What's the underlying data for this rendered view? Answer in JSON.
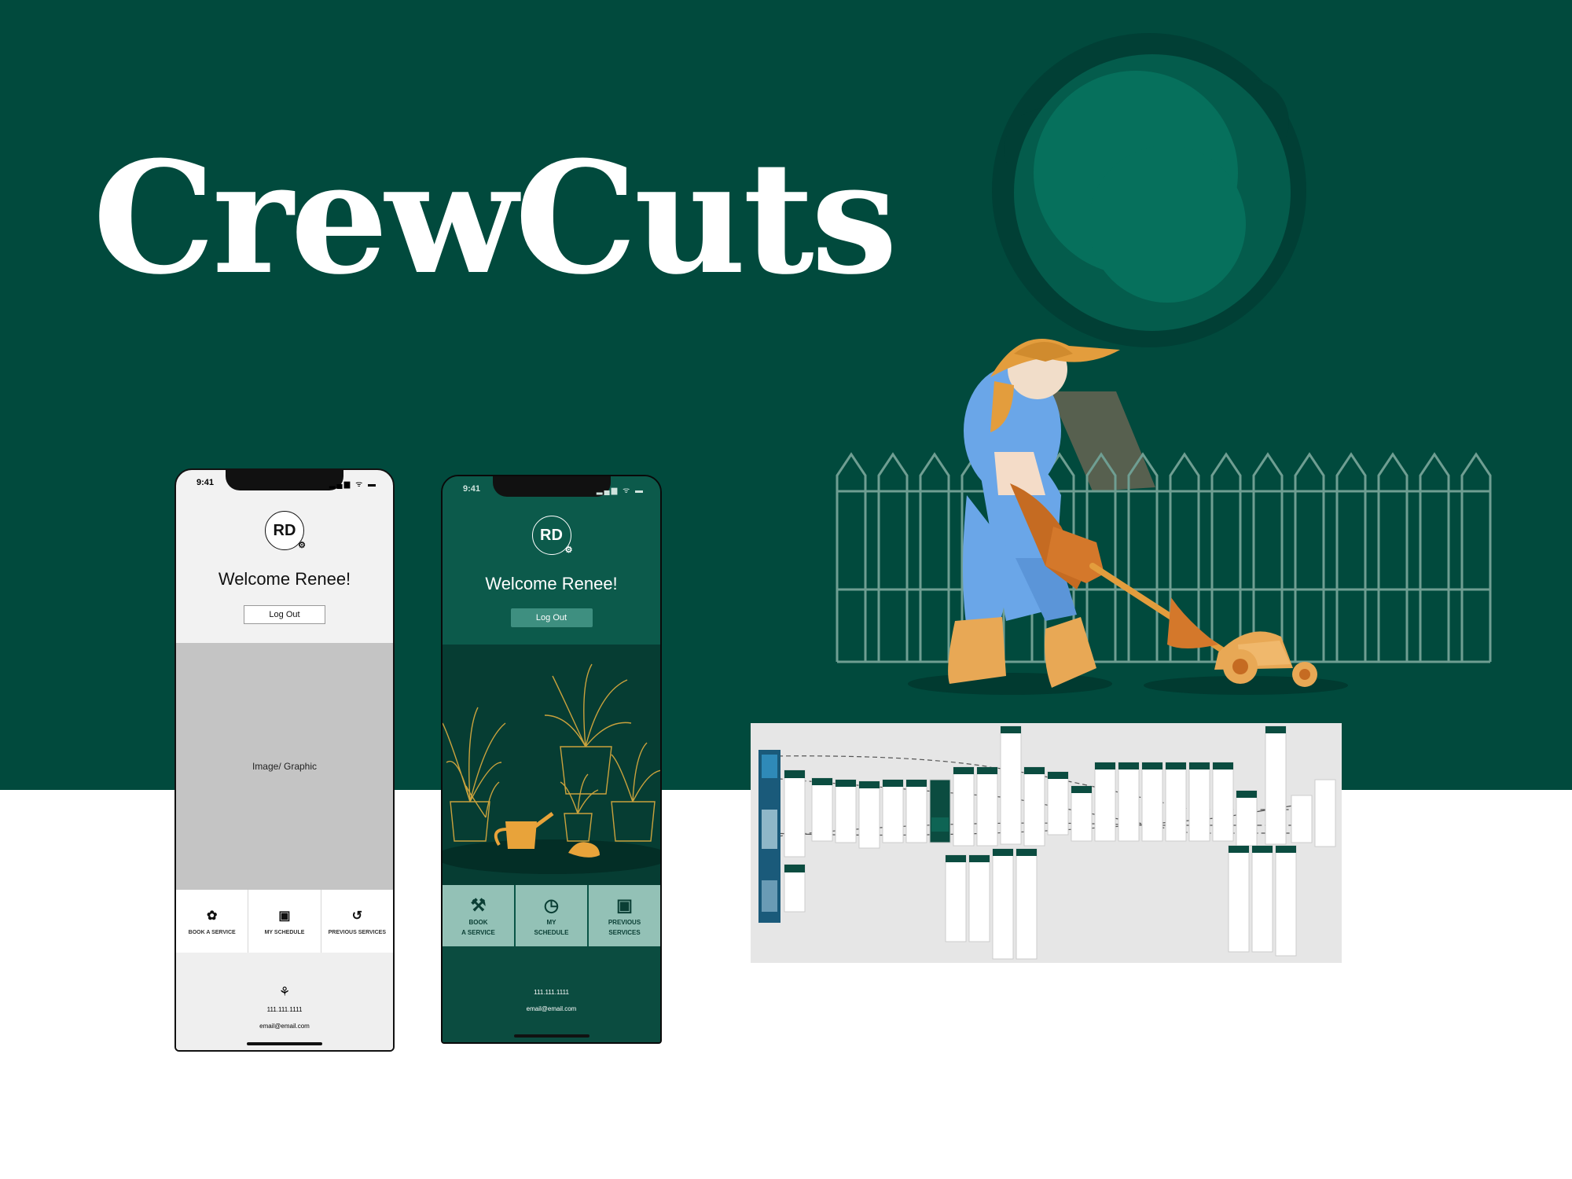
{
  "brand": {
    "title": "CrewCuts"
  },
  "colors": {
    "hero_green": "#014a3d",
    "accent_orange": "#e39d3d",
    "overalls_blue": "#6aa6e8"
  },
  "wireframe_phone": {
    "time": "9:41",
    "status_icons": "▂▄▆ ᯤ ▬",
    "avatar": "RD",
    "welcome": "Welcome Renee!",
    "logout_label": "Log Out",
    "hero_placeholder": "Image/ Graphic",
    "nav": [
      {
        "label": "BOOK A SERVICE",
        "icon": "flower-pin-icon"
      },
      {
        "label": "MY SCHEDULE",
        "icon": "calendar-icon"
      },
      {
        "label": "PREVIOUS SERVICES",
        "icon": "history-icon"
      }
    ],
    "phone": "111.111.1111",
    "email": "email@email.com"
  },
  "green_phone": {
    "time": "9:41",
    "status_icons": "▂▄▆ ᯤ ▬",
    "avatar": "RD",
    "welcome": "Welcome Renee!",
    "logout_label": "Log Out",
    "nav": [
      {
        "line1": "BOOK",
        "line2": "A SERVICE",
        "icon": "tools-icon"
      },
      {
        "line1": "MY",
        "line2": "SCHEDULE",
        "icon": "clock-icon"
      },
      {
        "line1": "PREVIOUS",
        "line2": "SERVICES",
        "icon": "calendar-check-icon"
      }
    ],
    "phone": "111.111.1111",
    "email": "email@email.com"
  }
}
